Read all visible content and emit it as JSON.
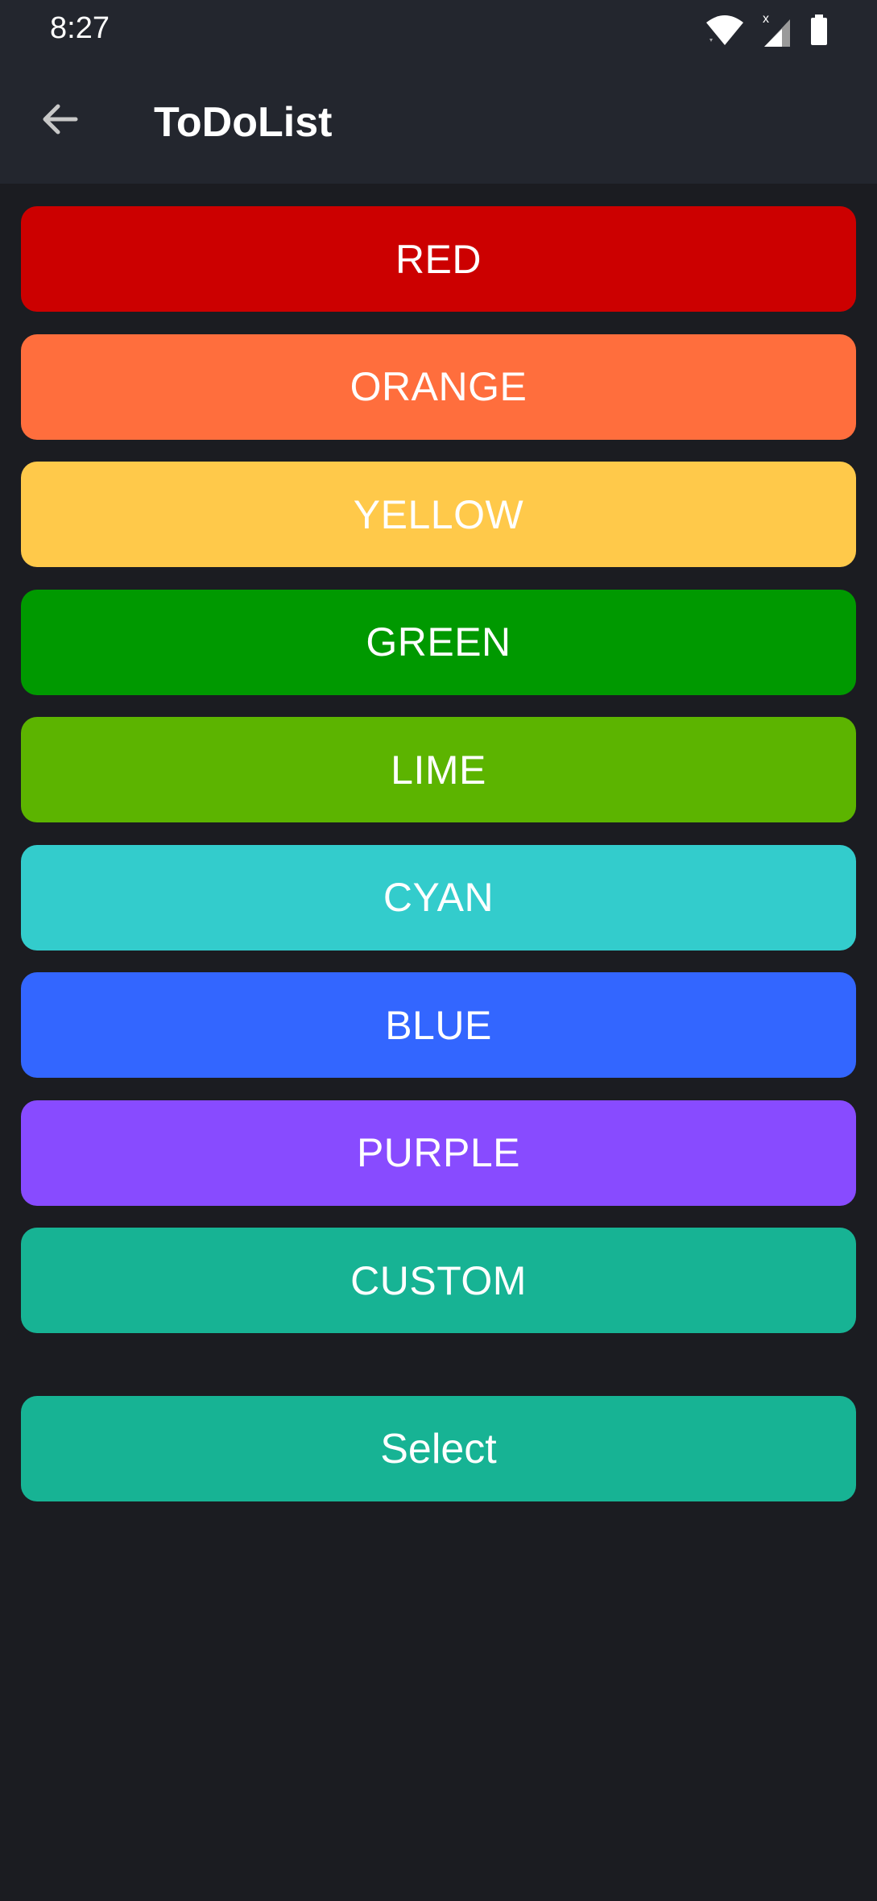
{
  "status_bar": {
    "time": "8:27",
    "icons": [
      "wifi-icon",
      "signal-icon",
      "battery-icon"
    ]
  },
  "app_bar": {
    "title": "ToDoList",
    "back_icon": "arrow-left-icon"
  },
  "colors": [
    {
      "label": "RED",
      "color": "#cc0000"
    },
    {
      "label": "ORANGE",
      "color": "#ff6e3d"
    },
    {
      "label": "YELLOW",
      "color": "#ffc94a"
    },
    {
      "label": "GREEN",
      "color": "#009900"
    },
    {
      "label": "LIME",
      "color": "#5cb400"
    },
    {
      "label": "CYAN",
      "color": "#33cccc"
    },
    {
      "label": "BLUE",
      "color": "#3366ff"
    },
    {
      "label": "PURPLE",
      "color": "#884bff"
    },
    {
      "label": "CUSTOM",
      "color": "#17b394"
    }
  ],
  "select_button": {
    "label": "Select",
    "color": "#17b394"
  }
}
